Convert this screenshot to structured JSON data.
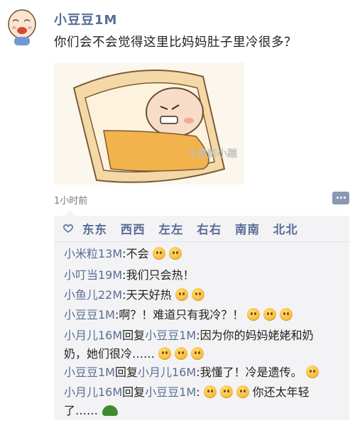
{
  "post": {
    "poster_name": "小豆豆1M",
    "text": "你们会不会觉得这里比妈妈肚子里冷很多？",
    "image_watermark": "十里彭小蹦",
    "time": "1小时前"
  },
  "likes": {
    "names": [
      "东东",
      "西西",
      "左左",
      "右右",
      "南南",
      "北北"
    ]
  },
  "comments": [
    {
      "from": "小米粒13M",
      "reply_to": "",
      "text": "不会",
      "emoji_count": 2
    },
    {
      "from": "小叮当19M",
      "reply_to": "",
      "text": "我们只会热！",
      "emoji_count": 0
    },
    {
      "from": "小鱼儿22M",
      "reply_to": "",
      "text": "天天好热",
      "emoji_count": 2
    },
    {
      "from": "小豆豆1M",
      "reply_to": "",
      "text": "啊？！难道只有我冷？！",
      "emoji_count": 3
    },
    {
      "from": "小月儿16M",
      "reply_to": "小豆豆1M",
      "text_line1": "因为你的妈妈姥姥和奶",
      "text_line2": "奶，她们很冷……",
      "emoji_count": 3
    },
    {
      "from": "小豆豆1M",
      "reply_to": "小月儿16M",
      "text": "我懂了！冷是遗传。",
      "emoji_count": 1
    },
    {
      "from": "小月儿16M",
      "reply_to": "小豆豆1M",
      "text_a": "你还太年轻",
      "text_b": "了……",
      "emoji_count": 4
    }
  ],
  "labels": {
    "reply": "回复"
  }
}
